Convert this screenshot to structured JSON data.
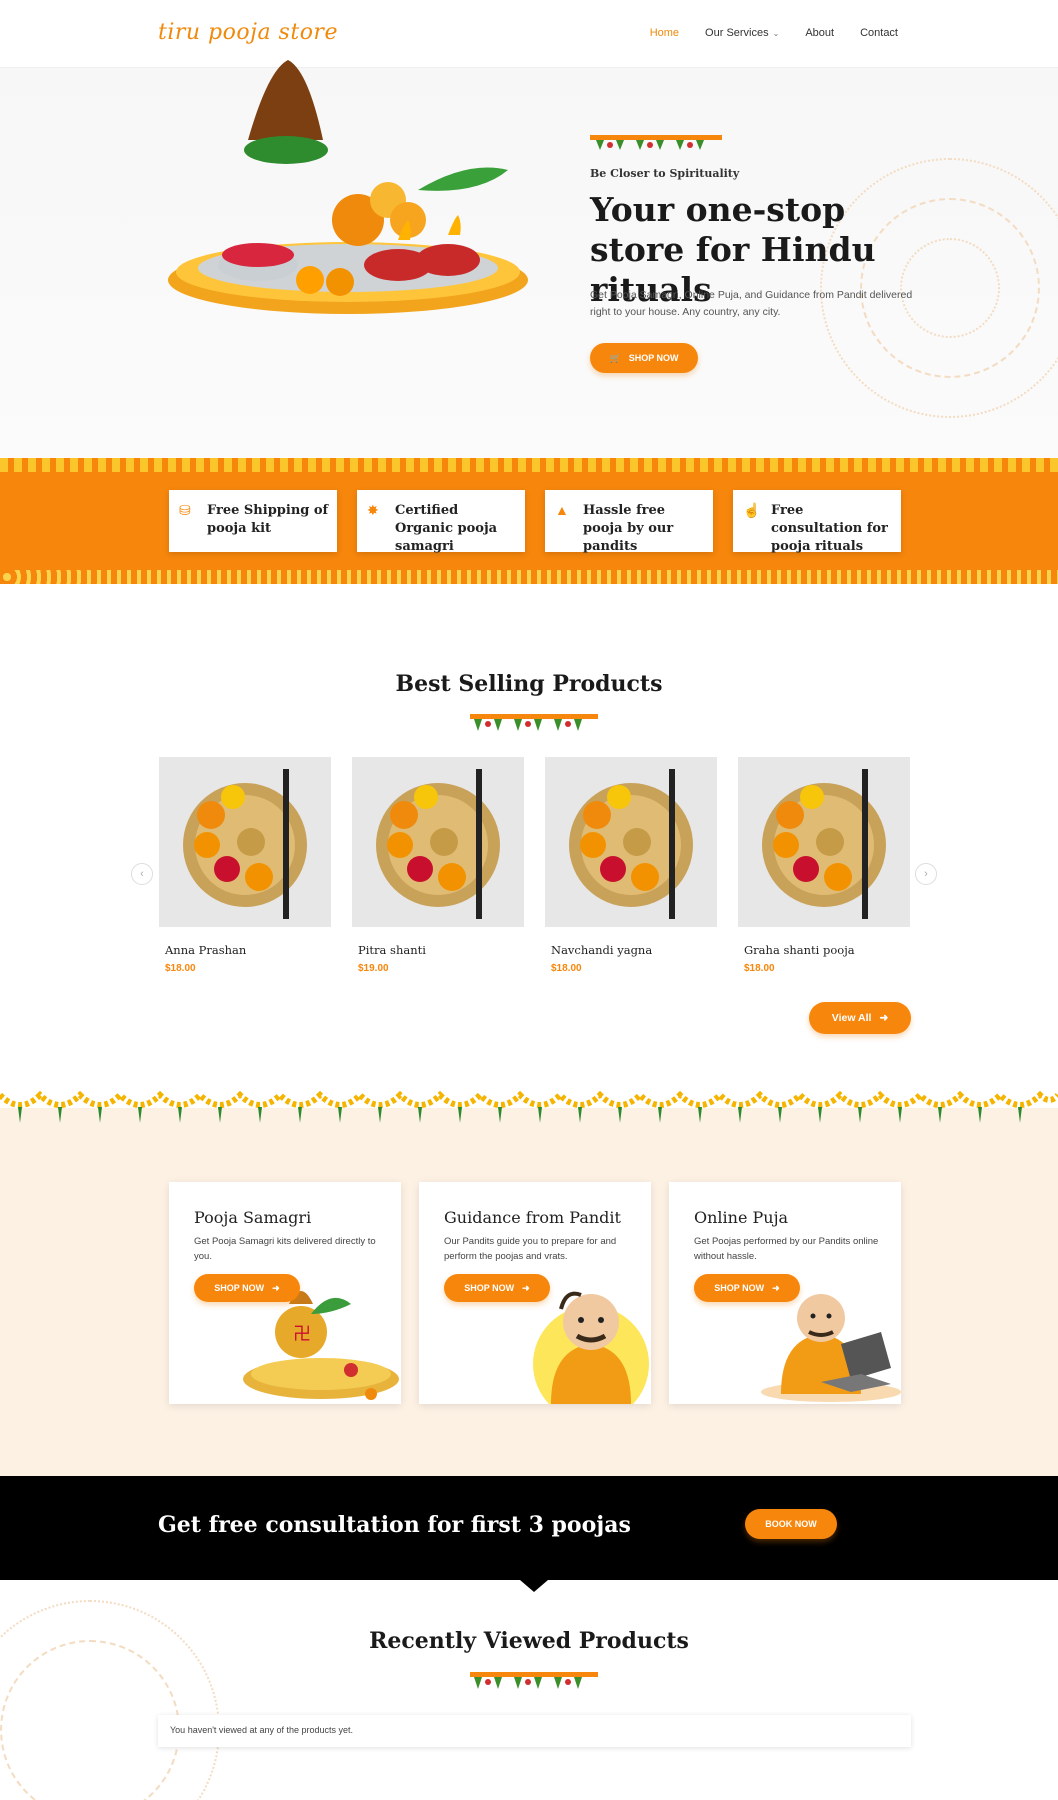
{
  "nav": {
    "logo": "tiru pooja store",
    "items": [
      {
        "label": "Home"
      },
      {
        "label": "Our Services"
      },
      {
        "label": "About"
      },
      {
        "label": "Contact"
      }
    ]
  },
  "hero": {
    "tagline": "Be Closer to Spirituality",
    "title": "Your one-stop store for Hindu rituals",
    "description": "Get Pooja Samagri, Online Puja, and Guidance from Pandit delivered right to your house. Any country, any city.",
    "button_label": "SHOP NOW"
  },
  "features": [
    {
      "icon": "truck-icon",
      "label": "Free Shipping of pooja kit"
    },
    {
      "icon": "badge-icon",
      "label": "Certified Organic pooja samagri"
    },
    {
      "icon": "praying-hands-icon",
      "label": "Hassle free pooja by our pandits"
    },
    {
      "icon": "handshake-icon",
      "label": "Free consultation for pooja rituals"
    }
  ],
  "best_selling": {
    "title": "Best Selling Products",
    "products": [
      {
        "name": "Anna Prashan",
        "price": "$18.00"
      },
      {
        "name": "Pitra shanti",
        "price": "$19.00"
      },
      {
        "name": "Navchandi yagna",
        "price": "$18.00"
      },
      {
        "name": "Graha shanti pooja",
        "price": "$18.00"
      }
    ],
    "view_all_label": "View All"
  },
  "services": [
    {
      "title": "Pooja Samagri",
      "description": "Get Pooja Samagri kits delivered directly to you.",
      "button_label": "SHOP NOW"
    },
    {
      "title": "Guidance from Pandit",
      "description": "Our Pandits guide you to prepare for and perform the poojas and vrats.",
      "button_label": "SHOP NOW"
    },
    {
      "title": "Online Puja",
      "description": "Get Poojas performed by our Pandits online without hassle.",
      "button_label": "SHOP NOW"
    }
  ],
  "cta": {
    "text": "Get free consultation for first 3 poojas",
    "button_label": "BOOK NOW"
  },
  "recent": {
    "title": "Recently Viewed Products",
    "empty_message": "You haven't viewed at any of the products yet."
  },
  "colors": {
    "accent": "#f7860c",
    "band_yellow": "#fbc62b",
    "services_bg": "#fdf1e4"
  }
}
